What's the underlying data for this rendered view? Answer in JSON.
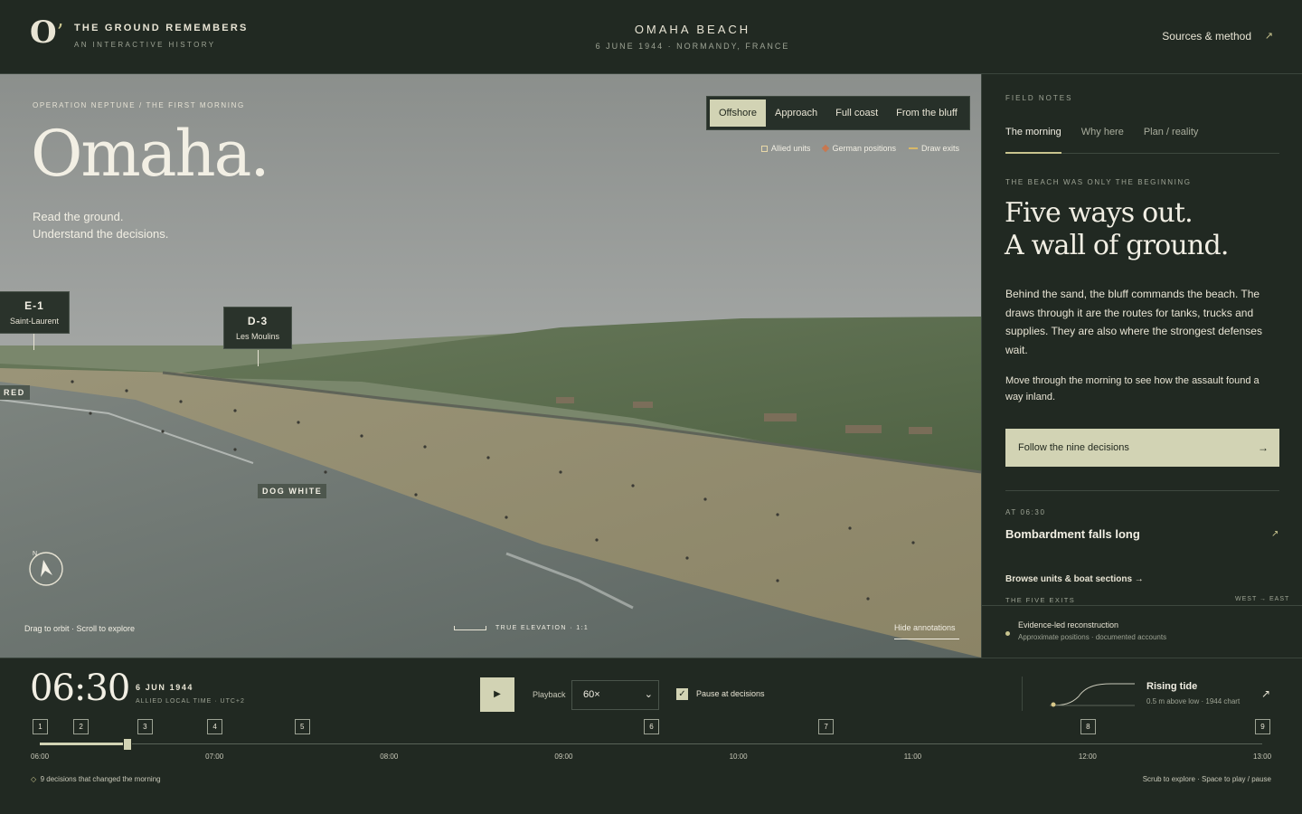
{
  "header": {
    "logo": "O",
    "logo_accent": "’",
    "brand_title": "THE GROUND REMEMBERS",
    "brand_sub": "AN INTERACTIVE HISTORY",
    "place_title": "OMAHA BEACH",
    "place_sub": "6 JUNE 1944 · NORMANDY, FRANCE",
    "sources_label": "Sources & method",
    "sources_icon": "↗"
  },
  "scene": {
    "breadcrumb": "OPERATION NEPTUNE / THE FIRST MORNING",
    "title": "Omaha.",
    "intro_line1": "Read the ground.",
    "intro_line2": "Understand the decisions.",
    "view_tabs": [
      "Offshore",
      "Approach",
      "Full coast",
      "From the bluff"
    ],
    "active_view": "Offshore",
    "legend": [
      {
        "label": "Allied units",
        "icon": "square-icon"
      },
      {
        "label": "German positions",
        "icon": "diamond-icon"
      },
      {
        "label": "Draw exits",
        "icon": "line-icon"
      }
    ],
    "exits": [
      {
        "code": "E-1",
        "name": "Saint-Laurent"
      },
      {
        "code": "D-3",
        "name": "Les Moulins"
      }
    ],
    "sectors": [
      "RED",
      "DOG WHITE"
    ],
    "compass_label": "N",
    "hint": "Drag to orbit · Scroll to explore",
    "scale_label": "TRUE ELEVATION · 1:1",
    "hide_annotations": "Hide annotations"
  },
  "sidebar": {
    "label": "FIELD NOTES",
    "tabs": [
      "The morning",
      "Why here",
      "Plan / reality"
    ],
    "active_tab": "The morning",
    "kicker": "THE BEACH WAS ONLY THE BEGINNING",
    "heading_line1": "Five ways out.",
    "heading_line2": "A wall of ground.",
    "paragraph1": "Behind the sand, the bluff commands the beach. The draws through it are the routes for tanks, trucks and supplies. They are also where the strongest defenses wait.",
    "paragraph2": "Move through the morning to see how the assault found a way inland.",
    "follow_button": "Follow the nine decisions",
    "follow_arrow": "→",
    "event_time": "AT 06:30",
    "event_title": "Bombardment falls long",
    "event_icon": "↗",
    "browse_link": "Browse units & boat sections →",
    "exits_label": "THE FIVE EXITS",
    "exits_direction": "WEST → EAST",
    "footer_title": "Evidence-led reconstruction",
    "footer_sub": "Approximate positions · documented accounts"
  },
  "timeline": {
    "clock": "06:30",
    "date": "6 JUN 1944",
    "zone": "ALLIED LOCAL TIME · UTC+2",
    "play_icon": "▶",
    "playback_label": "Playback",
    "speed": "60×",
    "speed_chevron": "⌄",
    "pause_checked": true,
    "pause_label": "Pause at decisions",
    "tide_title": "Rising tide",
    "tide_sub": "0.5 m above low · 1944 chart",
    "tide_icon": "↗",
    "start_time": "06:00",
    "end_time": "13:00",
    "current_time": "06:30",
    "hours": [
      "06:00",
      "07:00",
      "08:00",
      "09:00",
      "10:00",
      "11:00",
      "12:00",
      "13:00"
    ],
    "decision_markers": [
      {
        "n": "1",
        "time": "06:00"
      },
      {
        "n": "2",
        "time": "06:14"
      },
      {
        "n": "3",
        "time": "06:36"
      },
      {
        "n": "4",
        "time": "07:00"
      },
      {
        "n": "5",
        "time": "07:30"
      },
      {
        "n": "6",
        "time": "09:30"
      },
      {
        "n": "7",
        "time": "10:30"
      },
      {
        "n": "8",
        "time": "12:00"
      },
      {
        "n": "9",
        "time": "13:00"
      }
    ],
    "decisions_note": "9 decisions that changed the morning",
    "decisions_icon": "◇",
    "shortcuts_note": "Scrub to explore · Space to play / pause"
  },
  "colors": {
    "background": "#202822",
    "accent": "#d2d3b4",
    "gold": "#c8c48e",
    "german": "#c87850",
    "exit_line": "#d8b868"
  }
}
